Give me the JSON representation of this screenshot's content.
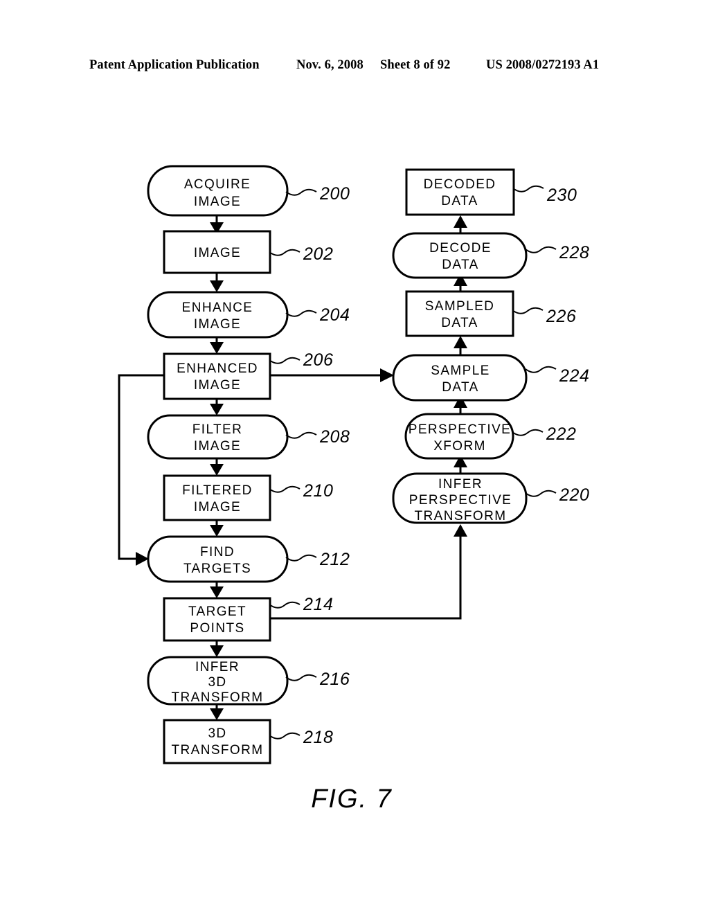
{
  "header": {
    "publication": "Patent Application Publication",
    "date": "Nov. 6, 2008",
    "sheet": "Sheet 8 of 92",
    "doc_id": "US 2008/0272193 A1"
  },
  "figure": {
    "caption": "FIG. 7",
    "nodes": {
      "n200": {
        "ref": "200",
        "lines": [
          "ACQUIRE",
          "IMAGE"
        ],
        "shape": "rounded"
      },
      "n202": {
        "ref": "202",
        "lines": [
          "IMAGE"
        ],
        "shape": "rect"
      },
      "n204": {
        "ref": "204",
        "lines": [
          "ENHANCE",
          "IMAGE"
        ],
        "shape": "rounded"
      },
      "n206": {
        "ref": "206",
        "lines": [
          "ENHANCED",
          "IMAGE"
        ],
        "shape": "rect"
      },
      "n208": {
        "ref": "208",
        "lines": [
          "FILTER",
          "IMAGE"
        ],
        "shape": "rounded"
      },
      "n210": {
        "ref": "210",
        "lines": [
          "FILTERED",
          "IMAGE"
        ],
        "shape": "rect"
      },
      "n212": {
        "ref": "212",
        "lines": [
          "FIND",
          "TARGETS"
        ],
        "shape": "rounded"
      },
      "n214": {
        "ref": "214",
        "lines": [
          "TARGET",
          "POINTS"
        ],
        "shape": "rect"
      },
      "n216": {
        "ref": "216",
        "lines": [
          "INFER",
          "3D",
          "TRANSFORM"
        ],
        "shape": "rounded"
      },
      "n218": {
        "ref": "218",
        "lines": [
          "3D",
          "TRANSFORM"
        ],
        "shape": "rect"
      },
      "n220": {
        "ref": "220",
        "lines": [
          "INFER",
          "PERSPECTIVE",
          "TRANSFORM"
        ],
        "shape": "rounded"
      },
      "n222": {
        "ref": "222",
        "lines": [
          "PERSPECTIVE",
          "XFORM"
        ],
        "shape": "rounded"
      },
      "n224": {
        "ref": "224",
        "lines": [
          "SAMPLE",
          "DATA"
        ],
        "shape": "rounded"
      },
      "n226": {
        "ref": "226",
        "lines": [
          "SAMPLED",
          "DATA"
        ],
        "shape": "rect"
      },
      "n228": {
        "ref": "228",
        "lines": [
          "DECODE",
          "DATA"
        ],
        "shape": "rounded"
      },
      "n230": {
        "ref": "230",
        "lines": [
          "DECODED",
          "DATA"
        ],
        "shape": "rect"
      }
    }
  }
}
